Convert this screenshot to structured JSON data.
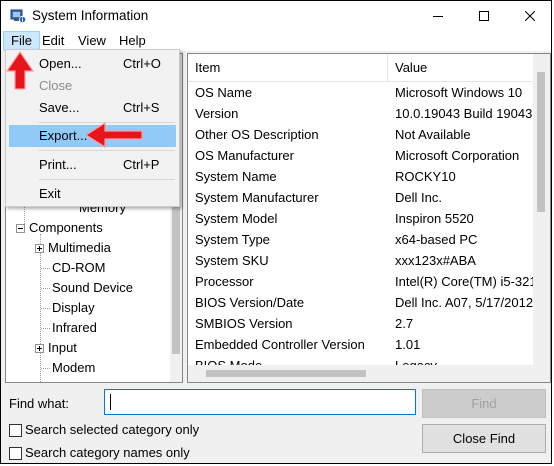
{
  "window": {
    "title": "System Information"
  },
  "menubar": {
    "items": [
      "File",
      "Edit",
      "View",
      "Help"
    ]
  },
  "file_menu": {
    "items": [
      {
        "label": "Open...",
        "shortcut": "Ctrl+O",
        "disabled": false
      },
      {
        "label": "Close",
        "shortcut": "",
        "disabled": true
      },
      {
        "label": "Save...",
        "shortcut": "Ctrl+S",
        "disabled": false
      },
      {
        "label": "Export...",
        "shortcut": "",
        "disabled": false,
        "highlighted": true
      },
      {
        "label": "Print...",
        "shortcut": "Ctrl+P",
        "disabled": false
      },
      {
        "label": "Exit",
        "shortcut": "",
        "disabled": false
      }
    ]
  },
  "tree": {
    "partial_top": "Memory",
    "components": "Components",
    "children": [
      "Multimedia",
      "CD-ROM",
      "Sound Device",
      "Display",
      "Infrared",
      "Input",
      "Modem"
    ]
  },
  "table": {
    "headers": [
      "Item",
      "Value"
    ],
    "rows": [
      [
        "OS Name",
        "Microsoft Windows 10"
      ],
      [
        "Version",
        "10.0.19043 Build 19043"
      ],
      [
        "Other OS Description",
        "Not Available"
      ],
      [
        "OS Manufacturer",
        "Microsoft Corporation"
      ],
      [
        "System Name",
        "ROCKY10"
      ],
      [
        "System Manufacturer",
        "Dell Inc."
      ],
      [
        "System Model",
        "Inspiron 5520"
      ],
      [
        "System Type",
        "x64-based PC"
      ],
      [
        "System SKU",
        "xxx123x#ABA"
      ],
      [
        "Processor",
        "Intel(R) Core(TM) i5-321"
      ],
      [
        "BIOS Version/Date",
        "Dell Inc. A07, 5/17/2012"
      ],
      [
        "SMBIOS Version",
        "2.7"
      ],
      [
        "Embedded Controller Version",
        "1.01"
      ],
      [
        "BIOS Mode",
        "Legacy"
      ]
    ]
  },
  "find": {
    "label": "Find what:",
    "value": "",
    "find_button": "Find",
    "close_find_button": "Close Find",
    "opt_selected": "Search selected category only",
    "opt_names": "Search category names only"
  },
  "colors": {
    "menu_highlight": "#91c9f7",
    "annotation_arrow": "#e8141b"
  }
}
